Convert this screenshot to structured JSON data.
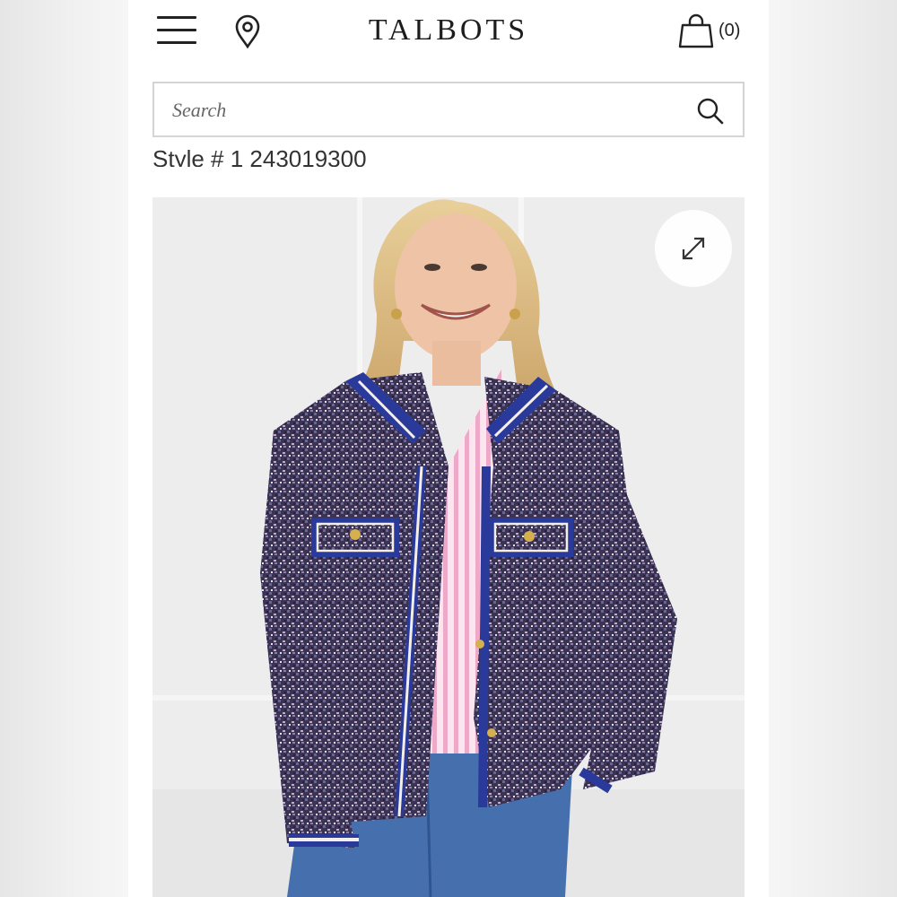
{
  "header": {
    "menu_icon": "hamburger-menu-icon",
    "location_icon": "map-pin-icon",
    "brand": "TALBOTS",
    "cart_icon": "shopping-bag-icon",
    "cart_count": "(0)"
  },
  "search": {
    "placeholder": "Search",
    "icon": "search-icon"
  },
  "product": {
    "style_number": "Style # 1 243019300",
    "expand_icon": "expand-arrows-icon"
  },
  "colors": {
    "page_background": "#ffffff",
    "jacket_tweed": "#3b3550",
    "jacket_trim": "#2a3a9a",
    "shirt": "#f2c9dc",
    "denim": "#3f6aa8"
  }
}
